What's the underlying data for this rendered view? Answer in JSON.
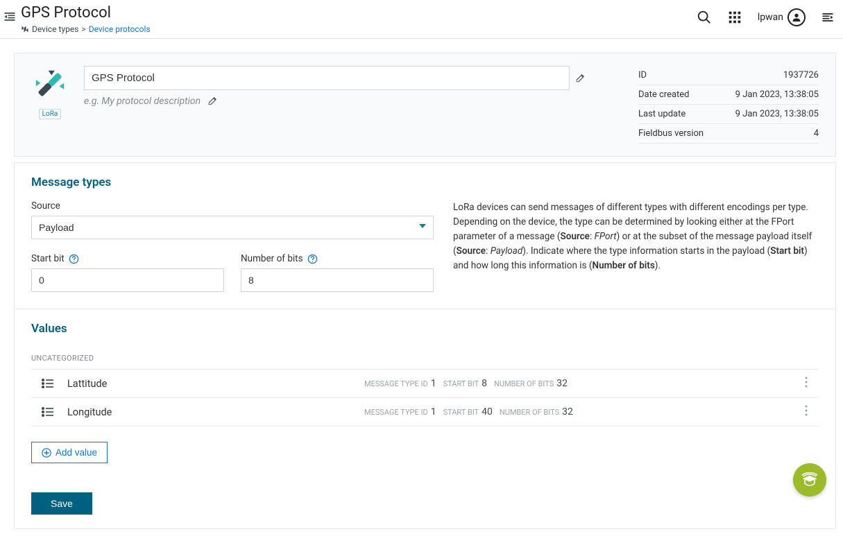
{
  "header": {
    "title": "GPS Protocol",
    "breadcrumb": {
      "root": "Device types",
      "current": "Device protocols"
    },
    "user": "lpwan"
  },
  "hero": {
    "badge": "LoRa",
    "name_value": "GPS Protocol",
    "desc_placeholder": "e.g. My protocol description",
    "meta": {
      "id_label": "ID",
      "id_value": "1937726",
      "created_label": "Date created",
      "created_value": "9 Jan 2023, 13:38:05",
      "updated_label": "Last update",
      "updated_value": "9 Jan 2023, 13:38:05",
      "fieldbus_label": "Fieldbus version",
      "fieldbus_value": "4"
    }
  },
  "message_types": {
    "title": "Message types",
    "source_label": "Source",
    "source_value": "Payload",
    "start_bit_label": "Start bit",
    "start_bit_value": "0",
    "num_bits_label": "Number of bits",
    "num_bits_value": "8",
    "help": {
      "p1": "LoRa devices can send messages of different types with different encodings per type. Depending on the device, the type can be determined by looking either at the FPort parameter of a message (",
      "s1": "Source",
      "c1": ": ",
      "f1": "FPort",
      "p2": ") or at the subset of the message payload itself (",
      "s2": "Source",
      "c2": ": ",
      "f2": "Payload",
      "p3": "). Indicate where the type information starts in the payload (",
      "s3": "Start bit",
      "p4": ") and how long this information is (",
      "s4": "Number of bits",
      "p5": ")."
    }
  },
  "values": {
    "title": "Values",
    "group": "UNCATEGORIZED",
    "labels": {
      "mtid": "MESSAGE TYPE ID",
      "sbit": "START BIT",
      "nbits": "NUMBER OF BITS"
    },
    "items": [
      {
        "name": "Lattitude",
        "mtid": "1",
        "sbit": "8",
        "nbits": "32"
      },
      {
        "name": "Longitude",
        "mtid": "1",
        "sbit": "40",
        "nbits": "32"
      }
    ],
    "add_label": "Add value"
  },
  "save_label": "Save"
}
